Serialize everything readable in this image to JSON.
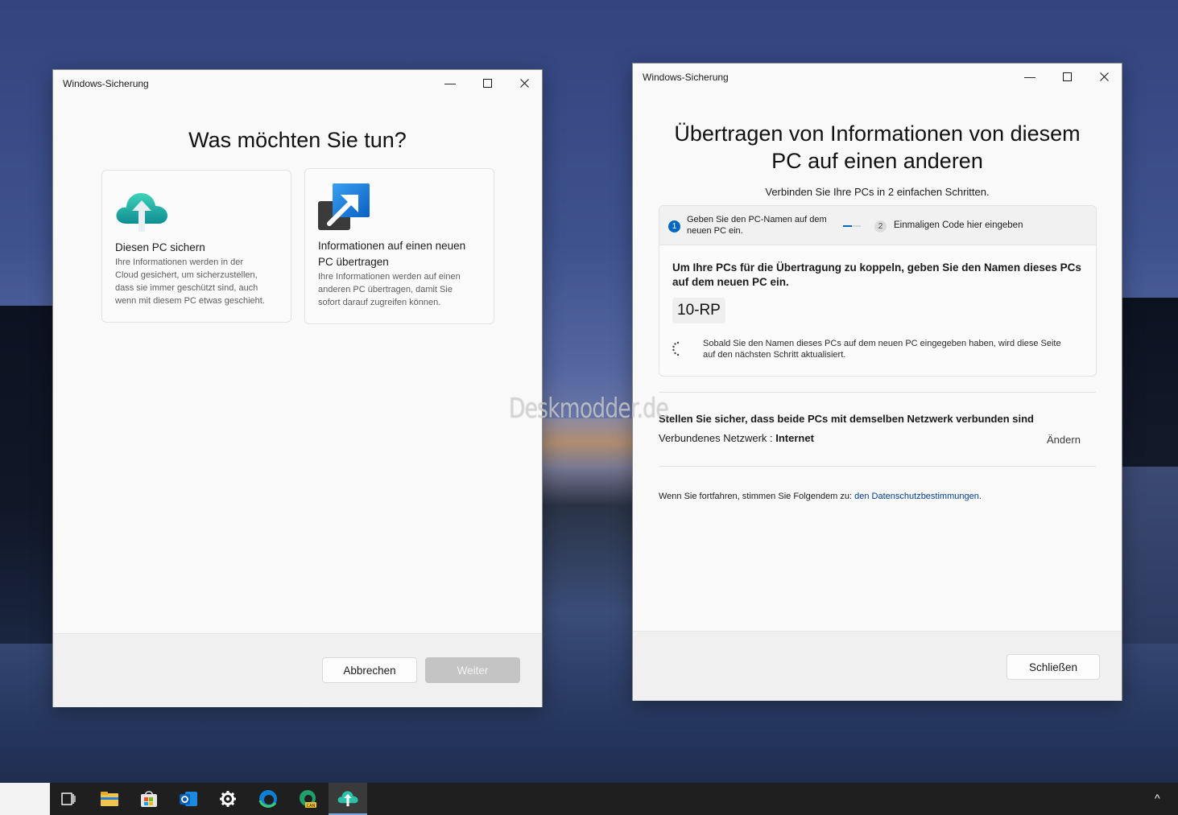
{
  "window_left": {
    "title": "Windows-Sicherung",
    "controls": {
      "minimize": "—",
      "maximize": "☐",
      "close": "✕"
    },
    "heading": "Was möchten Sie tun?",
    "cards": [
      {
        "icon": "cloud-upload-icon",
        "title": "Diesen PC sichern",
        "description_lines": [
          "Ihre Informationen werden in der",
          "Cloud gesichert, um sicherzustellen,",
          "dass sie immer geschützt sind, auch",
          "wenn mit diesem PC etwas geschieht."
        ]
      },
      {
        "icon": "transfer-arrow-icon",
        "title_lines": [
          "Informationen auf einen neuen",
          "PC übertragen"
        ],
        "description_lines": [
          "Ihre Informationen werden auf einen",
          "anderen PC übertragen, damit Sie",
          "sofort darauf zugreifen können."
        ]
      }
    ],
    "buttons": {
      "cancel": "Abbrechen",
      "next": "Weiter"
    }
  },
  "window_right": {
    "title": "Windows-Sicherung",
    "controls": {
      "minimize": "—",
      "maximize": "☐",
      "close": "✕"
    },
    "heading_lines": [
      "Übertragen von Informationen von diesem",
      "PC auf einen anderen"
    ],
    "subtitle": "Verbinden Sie Ihre PCs in 2 einfachen Schritten.",
    "steps": [
      {
        "number": "1",
        "label_lines": [
          "Geben Sie den PC-Namen auf dem",
          "neuen PC ein."
        ],
        "active": true
      },
      {
        "number": "2",
        "label": "Einmaligen Code hier eingeben",
        "active": false
      }
    ],
    "step_progress": 0.5,
    "instruction_lines": [
      "Um Ihre PCs für die Übertragung zu koppeln, geben Sie den Namen dieses PCs",
      "auf dem neuen PC ein."
    ],
    "pc_name": "10-RP",
    "note_lines": [
      "Sobald Sie den Namen dieses PCs auf dem neuen PC eingegeben haben, wird diese Seite",
      "auf den nächsten Schritt aktualisiert."
    ],
    "network": {
      "heading": "Stellen Sie sicher, dass beide PCs mit demselben Netzwerk verbunden sind",
      "label": "Verbundenes Netzwerk : ",
      "value": "Internet",
      "change": "Ändern"
    },
    "privacy": {
      "text": "Wenn Sie fortfahren, stimmen Sie Folgendem zu: ",
      "link": "den Datenschutzbestimmungen."
    },
    "buttons": {
      "close": "Schließen"
    }
  },
  "watermark": "Deskmodder.de",
  "taskbar": {
    "icons": [
      "task-view-icon",
      "file-explorer-icon",
      "store-icon",
      "outlook-icon",
      "settings-icon",
      "edge-icon",
      "edge-canary-icon",
      "windows-backup-icon"
    ],
    "tray": "^"
  },
  "colors": {
    "accent": "#0067c0",
    "link": "#003e92",
    "disabled_button": "#c4c4c4"
  }
}
